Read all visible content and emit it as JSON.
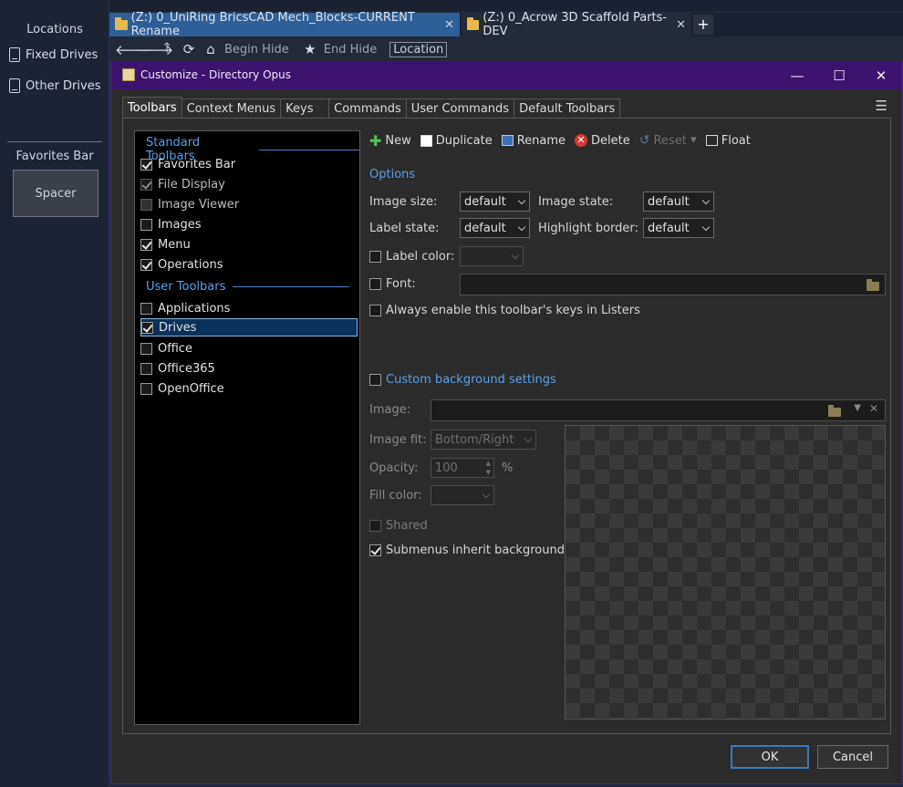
{
  "sidebar": {
    "locations_header": "Locations",
    "items": [
      {
        "label": "Fixed Drives"
      },
      {
        "label": "Other Drives"
      }
    ],
    "favorites_header": "Favorites Bar",
    "spacer_label": "Spacer"
  },
  "folder_tabs": [
    {
      "label": "(Z:) 0_UniRing BricsCAD Mech_Blocks-CURRENT Rename",
      "active": true
    },
    {
      "label": "(Z:) 0_Acrow 3D Scaffold Parts-DEV",
      "active": false
    }
  ],
  "nav": {
    "begin_hide": "Begin Hide",
    "end_hide": "End Hide",
    "location": "Location"
  },
  "dialog": {
    "title": "Customize - Directory Opus",
    "tabs": [
      "Toolbars",
      "Context Menus",
      "Keys",
      "Commands",
      "User Commands",
      "Default Toolbars"
    ],
    "active_tab": "Toolbars",
    "list": {
      "standard_header": "Standard Toolbars",
      "standard": [
        {
          "label": "Favorites Bar",
          "checked": true,
          "dim": false
        },
        {
          "label": "File Display",
          "checked": true,
          "dim": true
        },
        {
          "label": "Image Viewer",
          "checked": false,
          "dim": true
        },
        {
          "label": "Images",
          "checked": false,
          "dim": false
        },
        {
          "label": "Menu",
          "checked": true,
          "dim": false
        },
        {
          "label": "Operations",
          "checked": true,
          "dim": false
        }
      ],
      "user_header": "User Toolbars",
      "user": [
        {
          "label": "Applications",
          "checked": false
        },
        {
          "label": "Drives",
          "checked": true,
          "selected": true
        },
        {
          "label": "Office",
          "checked": false
        },
        {
          "label": "Office365",
          "checked": false
        },
        {
          "label": "OpenOffice",
          "checked": false
        }
      ]
    },
    "actions": {
      "new": "New",
      "duplicate": "Duplicate",
      "rename": "Rename",
      "delete": "Delete",
      "reset": "Reset",
      "float": "Float"
    },
    "options": {
      "header": "Options",
      "image_size_label": "Image size:",
      "image_size_value": "default",
      "image_state_label": "Image state:",
      "image_state_value": "default",
      "label_state_label": "Label state:",
      "label_state_value": "default",
      "highlight_border_label": "Highlight border:",
      "highlight_border_value": "default",
      "label_color_label": "Label color:",
      "font_label": "Font:",
      "always_enable_label": "Always enable this toolbar's keys in Listers"
    },
    "background": {
      "header": "Custom background settings",
      "image_label": "Image:",
      "image_fit_label": "Image fit:",
      "image_fit_value": "Bottom/Right",
      "opacity_label": "Opacity:",
      "opacity_value": "100",
      "opacity_unit": "%",
      "fill_color_label": "Fill color:",
      "shared_label": "Shared",
      "submenus_label": "Submenus inherit background",
      "submenus_checked": true
    },
    "ok_label": "OK",
    "cancel_label": "Cancel"
  }
}
